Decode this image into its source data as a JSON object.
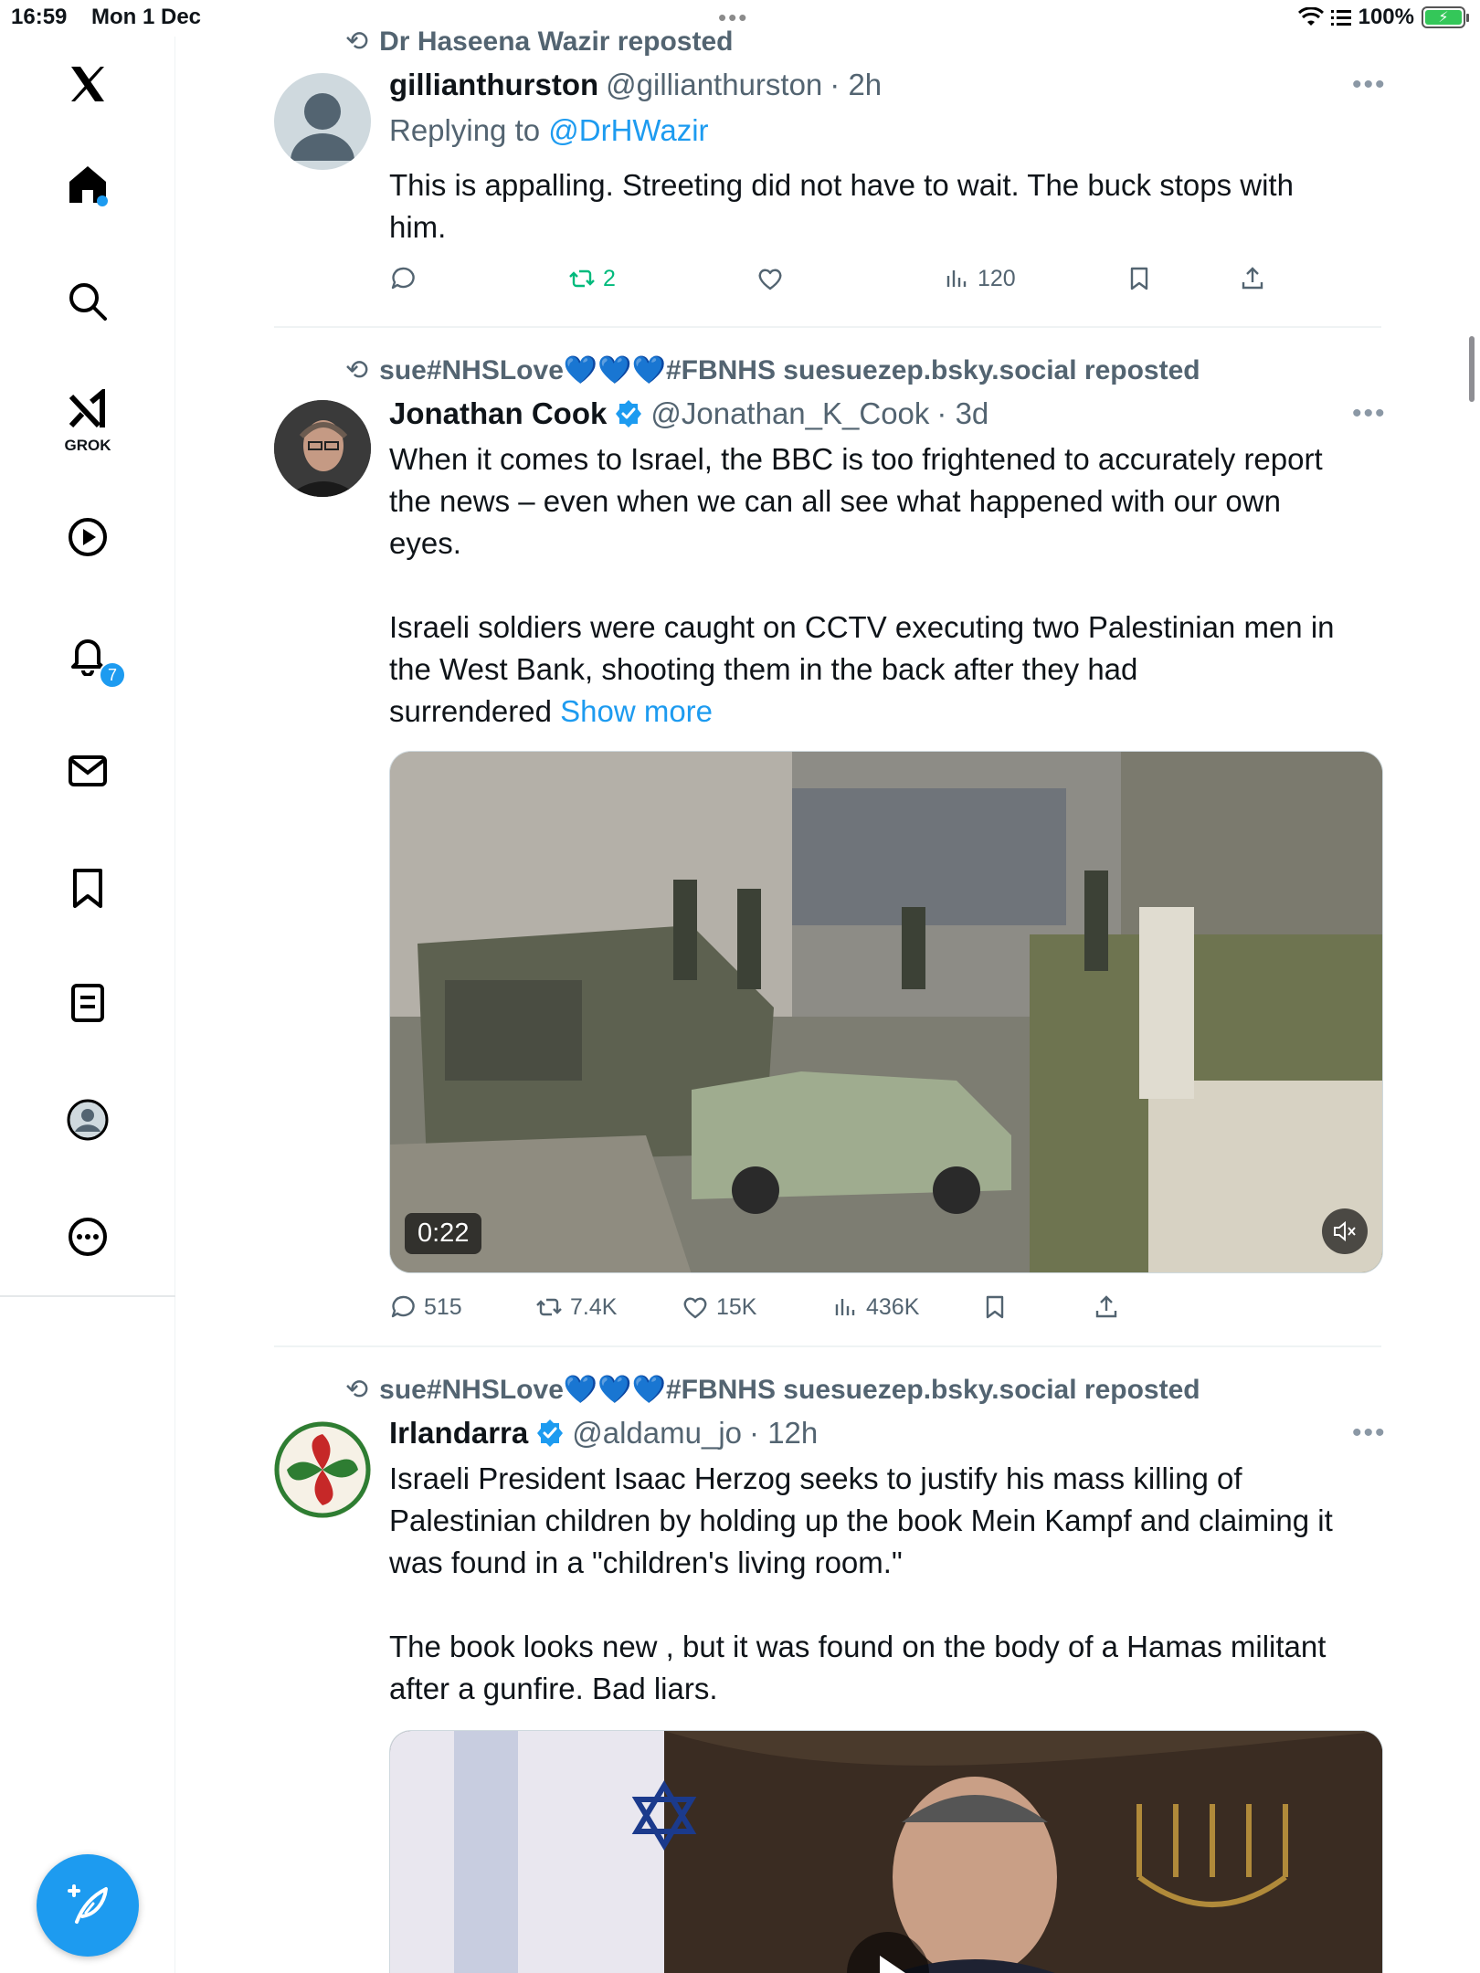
{
  "status_bar": {
    "time": "16:59",
    "date": "Mon 1 Dec",
    "battery": "100%"
  },
  "sidebar": {
    "grok_label": "GROK",
    "notifications_badge": "7"
  },
  "posts": [
    {
      "reposted_by": "Dr Haseena Wazir reposted",
      "display_name": "gillianthurston",
      "handle": "@gillianthurston",
      "time": "· 2h",
      "replying_prefix": "Replying to",
      "replying_to": "@DrHWazir",
      "text_lines": [
        "This is appalling. Streeting did not have to wait. The buck stops with",
        "him."
      ],
      "reposts": "2",
      "views": "120"
    },
    {
      "reposted_by_prefix": "sue#NHSLove",
      "reposted_by_suffix": "#FBNHS suesuezep.bsky.social reposted",
      "display_name": "Jonathan Cook",
      "handle": "@Jonathan_K_Cook",
      "time": "· 3d",
      "para1": [
        "When it comes to Israel, the BBC is too frightened to accurately report",
        "the news – even when we can all see what happened with our own",
        "eyes."
      ],
      "para2": [
        "Israeli soldiers were caught on CCTV executing two Palestinian men in",
        "the West Bank, shooting them in the back after they had"
      ],
      "para2_last": "surrendered",
      "show_more": "Show more",
      "video_duration": "0:22",
      "replies": "515",
      "reposts": "7.4K",
      "likes": "15K",
      "views": "436K"
    },
    {
      "reposted_by_prefix": "sue#NHSLove",
      "reposted_by_suffix": "#FBNHS suesuezep.bsky.social reposted",
      "display_name": "Irlandarra",
      "handle": "@aldamu_jo",
      "time": "· 12h",
      "para1": [
        "Israeli President Isaac Herzog seeks to justify his mass killing of",
        "Palestinian children by holding up the book Mein Kampf and claiming it",
        "was found in a \"children's living room.\""
      ],
      "para2": [
        "The book looks new , but it was found on the body of a Hamas militant",
        "after a gunfire.  Bad liars."
      ]
    }
  ]
}
